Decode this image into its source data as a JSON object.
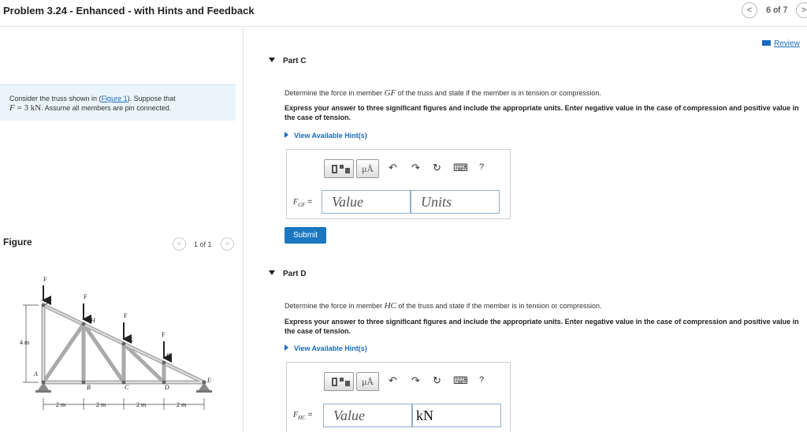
{
  "header": {
    "title": "Problem 3.24 - Enhanced - with Hints and Feedback",
    "prev": "<",
    "next": ">",
    "count": "6 of 7"
  },
  "review": "Review",
  "problem": {
    "text_a": "Consider the truss shown in (",
    "figure_link": "Figure 1",
    "text_b": "). Suppose that",
    "var_F": "F",
    "eq_value": " = 3 kN",
    "text_c": ". Assume all members are pin connected."
  },
  "figure": {
    "label": "Figure",
    "count": "1 of 1",
    "prev": "<",
    "next": ">",
    "truss": {
      "joints": [
        "A",
        "B",
        "C",
        "D",
        "E",
        "F",
        "G",
        "H",
        "I"
      ],
      "forces": [
        "F",
        "F",
        "F",
        "F"
      ],
      "height": "4 m",
      "spans": [
        "2 m",
        "2 m",
        "2 m",
        "2 m"
      ]
    }
  },
  "part_c": {
    "title": "Part C",
    "question_a": "Determine the force in member ",
    "member": "GF",
    "question_b": " of the truss and state if the member is in tension or compression.",
    "instructions": "Express your answer to three significant figures and include the appropriate units. Enter negative value in the case of compression and positive value in the case of tension.",
    "hint": "View Available Hint(s)",
    "var_label": "F",
    "var_sub": "GF",
    "equals": " =",
    "value_placeholder": "Value",
    "units_placeholder": "Units",
    "submit": "Submit"
  },
  "part_d": {
    "title": "Part D",
    "question_a": "Determine the force in member ",
    "member": "HC",
    "question_b": " of the truss and state if the member is in tension or compression.",
    "instructions": "Express your answer to three significant figures and include the appropriate units. Enter negative value in the case of compression and positive value in the case of tension.",
    "hint": "View Available Hint(s)",
    "var_label": "F",
    "var_sub": "HC",
    "equals": " =",
    "value_placeholder": "Value",
    "units_value": "kN"
  },
  "toolbar": {
    "mu_label": "μÅ",
    "undo": "↶",
    "redo": "↷",
    "reset": "↻",
    "keyboard": "⌨",
    "help": "?"
  },
  "colors": {
    "accent": "#1b77c0",
    "link": "#1a6bbf",
    "problem_bg": "#eaf4fb"
  }
}
